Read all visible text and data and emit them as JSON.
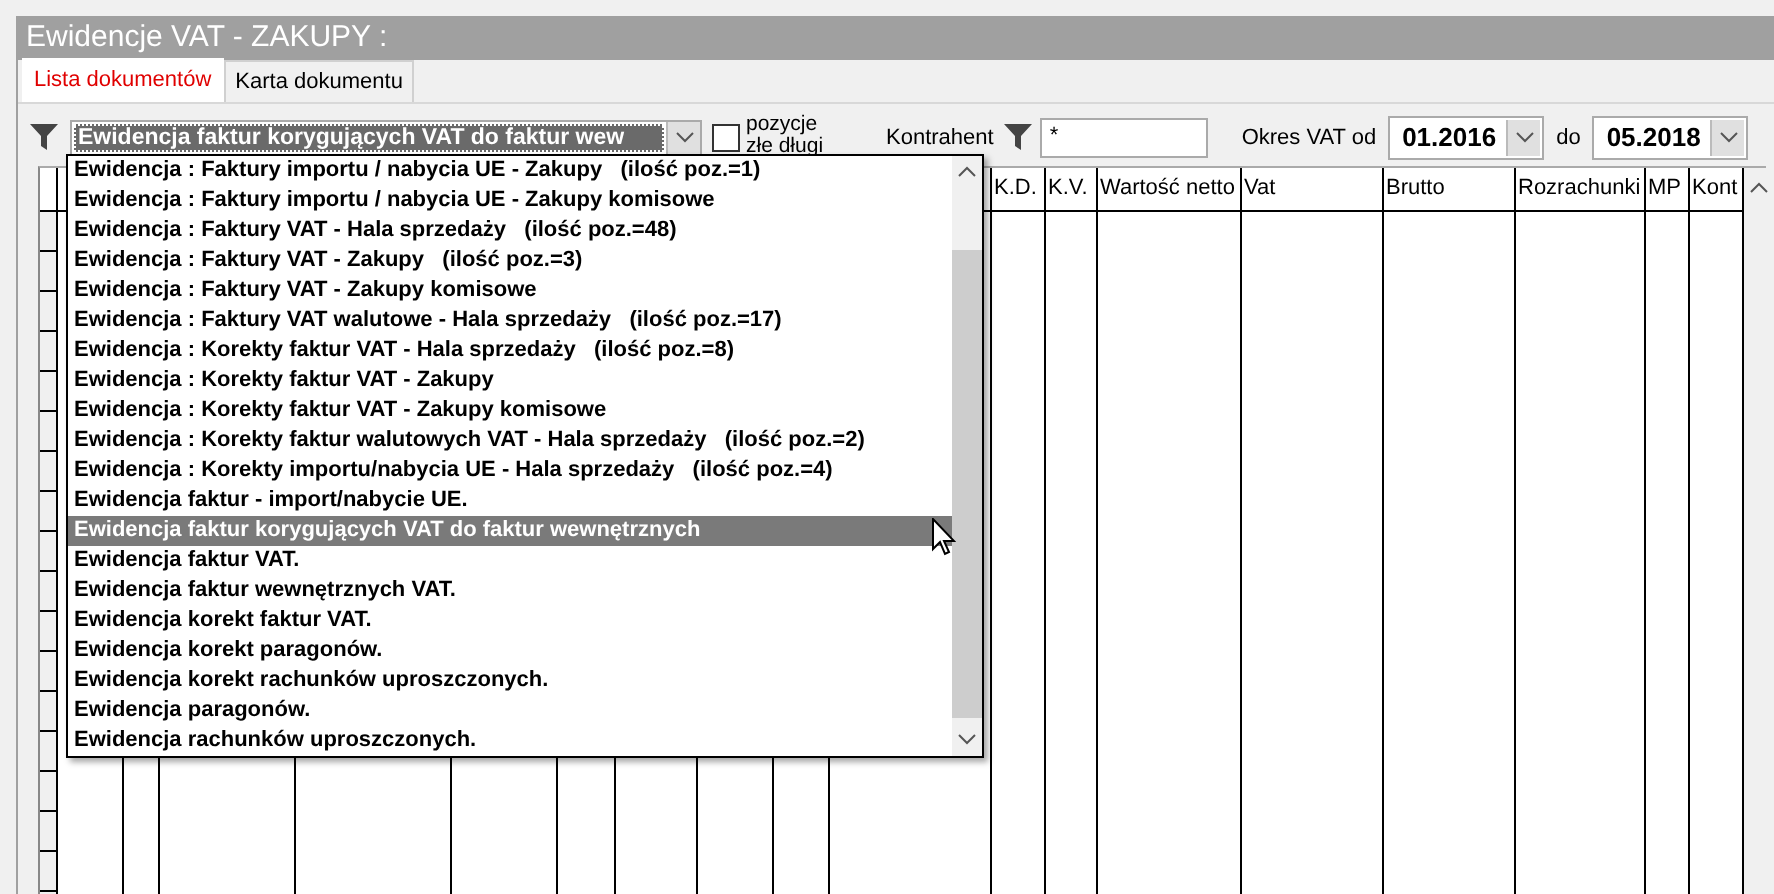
{
  "window": {
    "title": "Ewidencje VAT - ZAKUPY :"
  },
  "tabs": [
    {
      "label": "Lista dokumentów",
      "selected": true
    },
    {
      "label": "Karta dokumentu",
      "selected": false
    }
  ],
  "filter": {
    "register": "Ewidencja faktur korygujących VAT do faktur wew",
    "bad_positions": {
      "label": "pozycje złe długi",
      "checked": false
    },
    "contractor_label": "Kontrahent",
    "contractor": "*",
    "period_label": "Okres VAT od",
    "period_from": "01.2016",
    "to_label": "do",
    "period_to": "05.2018"
  },
  "dropdown": {
    "options": [
      {
        "label": "Ewidencja : Faktury importu / nabycia UE - Zakupy   (ilość poz.=1)",
        "selected": false
      },
      {
        "label": "Ewidencja : Faktury importu / nabycia UE - Zakupy komisowe",
        "selected": false
      },
      {
        "label": "Ewidencja : Faktury VAT - Hala sprzedaży   (ilość poz.=48)",
        "selected": false
      },
      {
        "label": "Ewidencja : Faktury VAT - Zakupy   (ilość poz.=3)",
        "selected": false
      },
      {
        "label": "Ewidencja : Faktury VAT - Zakupy komisowe",
        "selected": false
      },
      {
        "label": "Ewidencja : Faktury VAT walutowe - Hala sprzedaży   (ilość poz.=17)",
        "selected": false
      },
      {
        "label": "Ewidencja : Korekty faktur VAT - Hala sprzedaży   (ilość poz.=8)",
        "selected": false
      },
      {
        "label": "Ewidencja : Korekty faktur VAT - Zakupy",
        "selected": false
      },
      {
        "label": "Ewidencja : Korekty faktur VAT - Zakupy komisowe",
        "selected": false
      },
      {
        "label": "Ewidencja : Korekty faktur walutowych VAT - Hala sprzedaży   (ilość poz.=2)",
        "selected": false
      },
      {
        "label": "Ewidencja : Korekty importu/nabycia UE - Hala sprzedaży   (ilość poz.=4)",
        "selected": false
      },
      {
        "label": "Ewidencja faktur - import/nabycie UE.",
        "selected": false
      },
      {
        "label": "Ewidencja faktur korygujących VAT do faktur wewnętrznych",
        "selected": true
      },
      {
        "label": "Ewidencja faktur VAT.",
        "selected": false
      },
      {
        "label": "Ewidencja faktur wewnętrznych VAT.",
        "selected": false
      },
      {
        "label": "Ewidencja korekt faktur VAT.",
        "selected": false
      },
      {
        "label": "Ewidencja korekt paragonów.",
        "selected": false
      },
      {
        "label": "Ewidencja korekt rachunków uproszczonych.",
        "selected": false
      },
      {
        "label": "Ewidencja paragonów.",
        "selected": false
      },
      {
        "label": "Ewidencja rachunków uproszczonych.",
        "selected": false
      }
    ]
  },
  "table": {
    "columns": [
      "K.D.",
      "K.V.",
      "Wartość netto",
      "Vat",
      "Brutto",
      "Rozrachunki",
      "MP",
      "Kont"
    ]
  }
}
